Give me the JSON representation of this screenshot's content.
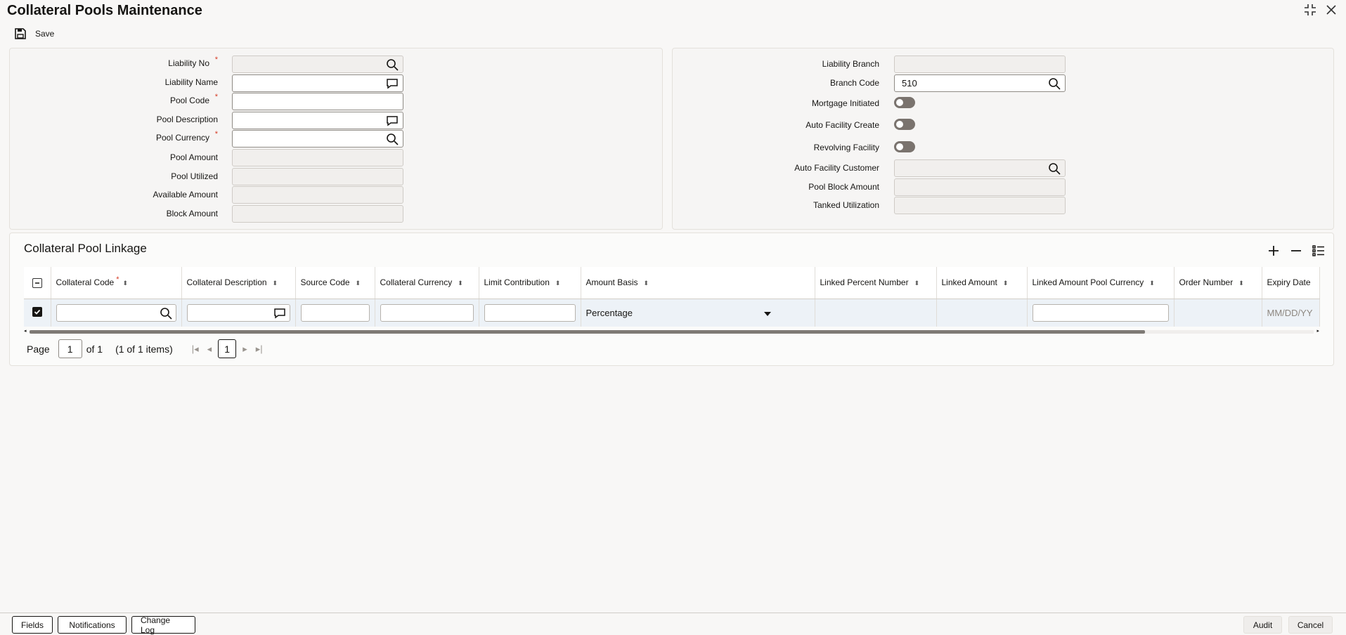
{
  "window": {
    "title": "Collateral Pools Maintenance"
  },
  "toolbar": {
    "save_label": "Save"
  },
  "left_form": {
    "liability_no": {
      "label": "Liability No",
      "value": ""
    },
    "liability_name": {
      "label": "Liability Name",
      "value": ""
    },
    "pool_code": {
      "label": "Pool Code",
      "value": ""
    },
    "pool_description": {
      "label": "Pool Description",
      "value": ""
    },
    "pool_currency": {
      "label": "Pool Currency",
      "value": ""
    },
    "pool_amount": {
      "label": "Pool Amount",
      "value": ""
    },
    "pool_utilized": {
      "label": "Pool Utilized",
      "value": ""
    },
    "available_amount": {
      "label": "Available Amount",
      "value": ""
    },
    "block_amount": {
      "label": "Block Amount",
      "value": ""
    },
    "required_mark": "*"
  },
  "right_form": {
    "liability_branch": {
      "label": "Liability Branch",
      "value": ""
    },
    "branch_code": {
      "label": "Branch Code",
      "value": "510"
    },
    "mortgage_initiated": {
      "label": "Mortgage Initiated",
      "checked": false
    },
    "auto_facility_create": {
      "label": "Auto Facility Create",
      "checked": false
    },
    "revolving_facility": {
      "label": "Revolving Facility",
      "checked": false
    },
    "auto_facility_customer": {
      "label": "Auto Facility Customer",
      "value": ""
    },
    "pool_block_amount": {
      "label": "Pool Block Amount",
      "value": ""
    },
    "tanked_utilization": {
      "label": "Tanked Utilization",
      "value": ""
    }
  },
  "grid": {
    "title": "Collateral Pool Linkage",
    "columns": [
      "Collateral Code",
      "Collateral Description",
      "Source Code",
      "Collateral Currency",
      "Limit Contribution",
      "Amount Basis",
      "Linked Percent Number",
      "Linked Amount",
      "Linked Amount Pool Currency",
      "Order Number",
      "Expiry Date"
    ],
    "row": {
      "amount_basis": "Percentage",
      "expiry_placeholder": "MM/DD/YY"
    },
    "pager": {
      "page_label": "Page",
      "page_value": "1",
      "of_label": "of 1",
      "items_label": "(1 of 1 items)",
      "current_page": "1"
    }
  },
  "footer": {
    "fields": "Fields",
    "notifications": "Notifications",
    "change_log": "Change Log",
    "audit": "Audit",
    "cancel": "Cancel"
  }
}
